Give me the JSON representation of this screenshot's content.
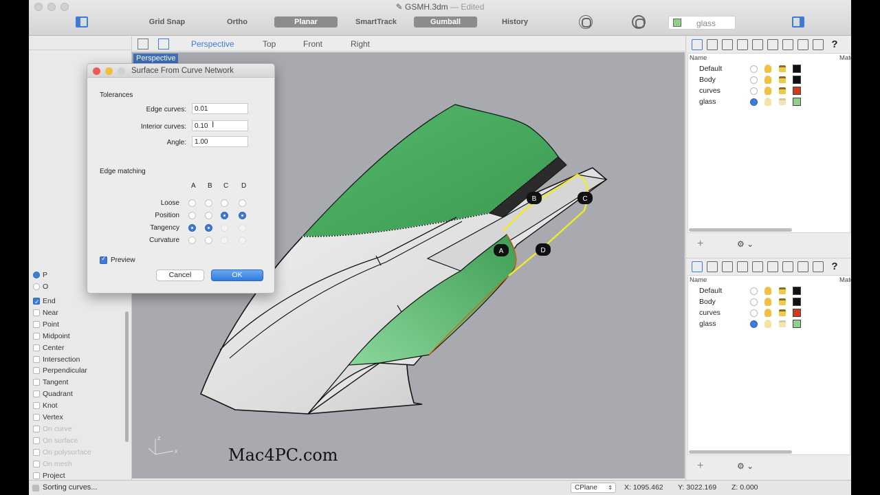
{
  "window": {
    "title": "GSMH.3dm",
    "separator": "—",
    "status": "Edited"
  },
  "toolbar": {
    "grid_snap": "Grid Snap",
    "ortho": "Ortho",
    "planar": "Planar",
    "smarttrack": "SmartTrack",
    "gumball": "Gumball",
    "history": "History",
    "layer_selector": "glass",
    "layer_color": "#8fd08a"
  },
  "viewport": {
    "tabs": [
      "Perspective",
      "Top",
      "Front",
      "Right"
    ],
    "active_tab": "Perspective",
    "label": "Perspective",
    "watermark": "Mac4PC.com",
    "axis_z": "z",
    "axis_x": "x",
    "markers": [
      "A",
      "B",
      "C",
      "D"
    ]
  },
  "osnaps": {
    "radio_items": [
      "P",
      "O"
    ],
    "items": [
      {
        "label": "End",
        "checked": true,
        "enabled": true
      },
      {
        "label": "Near",
        "checked": false,
        "enabled": true
      },
      {
        "label": "Point",
        "checked": false,
        "enabled": true
      },
      {
        "label": "Midpoint",
        "checked": false,
        "enabled": true
      },
      {
        "label": "Center",
        "checked": false,
        "enabled": true
      },
      {
        "label": "Intersection",
        "checked": false,
        "enabled": true
      },
      {
        "label": "Perpendicular",
        "checked": false,
        "enabled": true
      },
      {
        "label": "Tangent",
        "checked": false,
        "enabled": true
      },
      {
        "label": "Quadrant",
        "checked": false,
        "enabled": true
      },
      {
        "label": "Knot",
        "checked": false,
        "enabled": true
      },
      {
        "label": "Vertex",
        "checked": false,
        "enabled": true
      },
      {
        "label": "On curve",
        "checked": false,
        "enabled": false
      },
      {
        "label": "On surface",
        "checked": false,
        "enabled": false
      },
      {
        "label": "On polysurface",
        "checked": false,
        "enabled": false
      },
      {
        "label": "On mesh",
        "checked": false,
        "enabled": false
      },
      {
        "label": "Project",
        "checked": false,
        "enabled": true
      }
    ]
  },
  "dialog": {
    "title": "Surface From Curve Network",
    "tolerances_header": "Tolerances",
    "edge_curves_label": "Edge curves:",
    "edge_curves_value": "0.01",
    "interior_curves_label": "Interior curves:",
    "interior_curves_value": "0.10",
    "angle_label": "Angle:",
    "angle_value": "1.00",
    "edge_matching_header": "Edge matching",
    "columns": [
      "A",
      "B",
      "C",
      "D"
    ],
    "rows": [
      {
        "label": "Loose",
        "states": [
          "off",
          "off",
          "off",
          "off"
        ]
      },
      {
        "label": "Position",
        "states": [
          "off",
          "off",
          "on",
          "on"
        ]
      },
      {
        "label": "Tangency",
        "states": [
          "on",
          "on",
          "dis",
          "dis"
        ]
      },
      {
        "label": "Curvature",
        "states": [
          "off",
          "off",
          "dis",
          "dis"
        ]
      }
    ],
    "preview_label": "Preview",
    "cancel_label": "Cancel",
    "ok_label": "OK"
  },
  "layers": {
    "name_header": "Name",
    "material_header": "Materia",
    "rows": [
      {
        "name": "Default",
        "current": false,
        "on": true,
        "locked": true,
        "color": "#111111"
      },
      {
        "name": "Body",
        "current": false,
        "on": true,
        "locked": true,
        "color": "#111111"
      },
      {
        "name": "curves",
        "current": false,
        "on": true,
        "locked": true,
        "color": "#d23a1e"
      },
      {
        "name": "glass",
        "current": true,
        "on": false,
        "locked": false,
        "color": "#8fd08a"
      }
    ],
    "add_button": "+",
    "options_button": "⚙ ⌄"
  },
  "status": {
    "message": "Sorting curves...",
    "cplane": "CPlane",
    "x": "X: 1095.462",
    "y": "Y: 3022.169",
    "z": "Z: 0.000"
  }
}
